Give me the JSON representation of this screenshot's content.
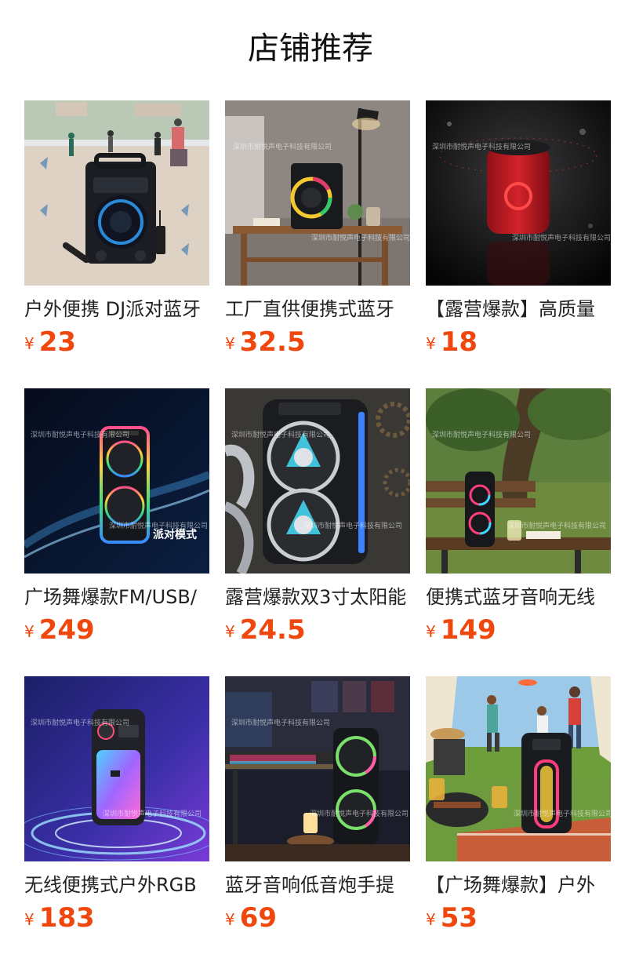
{
  "page": {
    "title": "店铺推荐"
  },
  "products": [
    {
      "name": "户外便携 DJ派对蓝牙",
      "currency": "¥",
      "price": "23",
      "image_icon": "party-speaker-plaza-image"
    },
    {
      "name": "工厂直供便携式蓝牙",
      "currency": "¥",
      "price": "32.5",
      "image_icon": "speaker-on-table-image",
      "watermark": "深圳市耐悦声电子科技有限公司"
    },
    {
      "name": "【露营爆款】高质量",
      "currency": "¥",
      "price": "18",
      "image_icon": "red-mini-speaker-image",
      "watermark": "深圳市耐悦声电子科技有限公司"
    },
    {
      "name": "广场舞爆款FM/USB/",
      "currency": "¥",
      "price": "249",
      "image_icon": "rgb-tower-speaker-image",
      "watermark": "深圳市耐悦声电子科技有限公司",
      "badge": "派对模式"
    },
    {
      "name": "露营爆款双3寸太阳能",
      "currency": "¥",
      "price": "24.5",
      "image_icon": "robot-speaker-image",
      "watermark": "深圳市耐悦声电子科技有限公司"
    },
    {
      "name": "便携式蓝牙音响无线",
      "currency": "¥",
      "price": "149",
      "image_icon": "park-bench-speaker-image",
      "watermark": "深圳市耐悦声电子科技有限公司"
    },
    {
      "name": "无线便携式户外RGB",
      "currency": "¥",
      "price": "183",
      "image_icon": "glitter-speaker-image",
      "watermark": "深圳市耐悦声电子科技有限公司"
    },
    {
      "name": "蓝牙音响低音炮手提",
      "currency": "¥",
      "price": "69",
      "image_icon": "gaming-desk-speaker-image",
      "watermark": "深圳市耐悦声电子科技有限公司"
    },
    {
      "name": "【广场舞爆款】户外",
      "currency": "¥",
      "price": "53",
      "image_icon": "picnic-party-speaker-image",
      "watermark": "深圳市耐悦声电子科技有限公司"
    }
  ],
  "colors": {
    "price": "#f0470e",
    "text": "#222222",
    "background": "#ffffff"
  }
}
